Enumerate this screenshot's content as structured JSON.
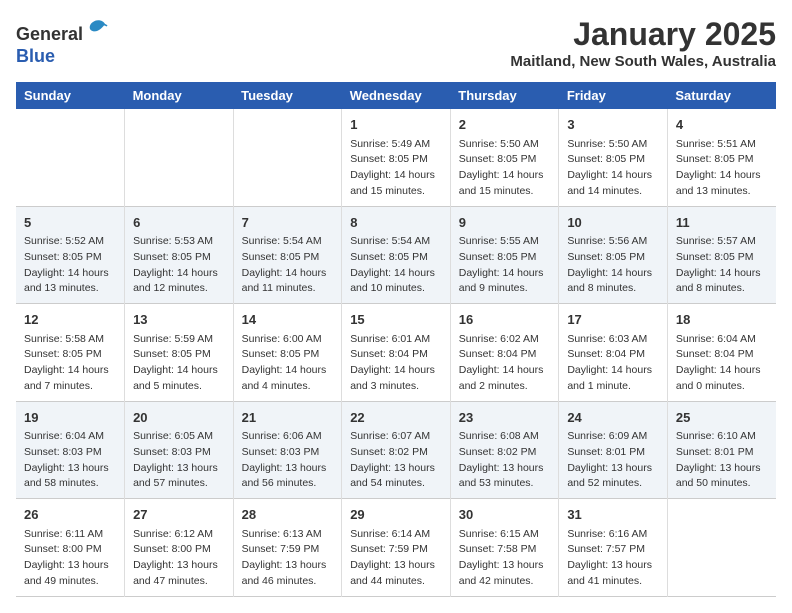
{
  "header": {
    "logo_line1": "General",
    "logo_line2": "Blue",
    "month_year": "January 2025",
    "location": "Maitland, New South Wales, Australia"
  },
  "days_of_week": [
    "Sunday",
    "Monday",
    "Tuesday",
    "Wednesday",
    "Thursday",
    "Friday",
    "Saturday"
  ],
  "weeks": [
    [
      {
        "date": "",
        "info": ""
      },
      {
        "date": "",
        "info": ""
      },
      {
        "date": "",
        "info": ""
      },
      {
        "date": "1",
        "info": "Sunrise: 5:49 AM\nSunset: 8:05 PM\nDaylight: 14 hours and 15 minutes."
      },
      {
        "date": "2",
        "info": "Sunrise: 5:50 AM\nSunset: 8:05 PM\nDaylight: 14 hours and 15 minutes."
      },
      {
        "date": "3",
        "info": "Sunrise: 5:50 AM\nSunset: 8:05 PM\nDaylight: 14 hours and 14 minutes."
      },
      {
        "date": "4",
        "info": "Sunrise: 5:51 AM\nSunset: 8:05 PM\nDaylight: 14 hours and 13 minutes."
      }
    ],
    [
      {
        "date": "5",
        "info": "Sunrise: 5:52 AM\nSunset: 8:05 PM\nDaylight: 14 hours and 13 minutes."
      },
      {
        "date": "6",
        "info": "Sunrise: 5:53 AM\nSunset: 8:05 PM\nDaylight: 14 hours and 12 minutes."
      },
      {
        "date": "7",
        "info": "Sunrise: 5:54 AM\nSunset: 8:05 PM\nDaylight: 14 hours and 11 minutes."
      },
      {
        "date": "8",
        "info": "Sunrise: 5:54 AM\nSunset: 8:05 PM\nDaylight: 14 hours and 10 minutes."
      },
      {
        "date": "9",
        "info": "Sunrise: 5:55 AM\nSunset: 8:05 PM\nDaylight: 14 hours and 9 minutes."
      },
      {
        "date": "10",
        "info": "Sunrise: 5:56 AM\nSunset: 8:05 PM\nDaylight: 14 hours and 8 minutes."
      },
      {
        "date": "11",
        "info": "Sunrise: 5:57 AM\nSunset: 8:05 PM\nDaylight: 14 hours and 8 minutes."
      }
    ],
    [
      {
        "date": "12",
        "info": "Sunrise: 5:58 AM\nSunset: 8:05 PM\nDaylight: 14 hours and 7 minutes."
      },
      {
        "date": "13",
        "info": "Sunrise: 5:59 AM\nSunset: 8:05 PM\nDaylight: 14 hours and 5 minutes."
      },
      {
        "date": "14",
        "info": "Sunrise: 6:00 AM\nSunset: 8:05 PM\nDaylight: 14 hours and 4 minutes."
      },
      {
        "date": "15",
        "info": "Sunrise: 6:01 AM\nSunset: 8:04 PM\nDaylight: 14 hours and 3 minutes."
      },
      {
        "date": "16",
        "info": "Sunrise: 6:02 AM\nSunset: 8:04 PM\nDaylight: 14 hours and 2 minutes."
      },
      {
        "date": "17",
        "info": "Sunrise: 6:03 AM\nSunset: 8:04 PM\nDaylight: 14 hours and 1 minute."
      },
      {
        "date": "18",
        "info": "Sunrise: 6:04 AM\nSunset: 8:04 PM\nDaylight: 14 hours and 0 minutes."
      }
    ],
    [
      {
        "date": "19",
        "info": "Sunrise: 6:04 AM\nSunset: 8:03 PM\nDaylight: 13 hours and 58 minutes."
      },
      {
        "date": "20",
        "info": "Sunrise: 6:05 AM\nSunset: 8:03 PM\nDaylight: 13 hours and 57 minutes."
      },
      {
        "date": "21",
        "info": "Sunrise: 6:06 AM\nSunset: 8:03 PM\nDaylight: 13 hours and 56 minutes."
      },
      {
        "date": "22",
        "info": "Sunrise: 6:07 AM\nSunset: 8:02 PM\nDaylight: 13 hours and 54 minutes."
      },
      {
        "date": "23",
        "info": "Sunrise: 6:08 AM\nSunset: 8:02 PM\nDaylight: 13 hours and 53 minutes."
      },
      {
        "date": "24",
        "info": "Sunrise: 6:09 AM\nSunset: 8:01 PM\nDaylight: 13 hours and 52 minutes."
      },
      {
        "date": "25",
        "info": "Sunrise: 6:10 AM\nSunset: 8:01 PM\nDaylight: 13 hours and 50 minutes."
      }
    ],
    [
      {
        "date": "26",
        "info": "Sunrise: 6:11 AM\nSunset: 8:00 PM\nDaylight: 13 hours and 49 minutes."
      },
      {
        "date": "27",
        "info": "Sunrise: 6:12 AM\nSunset: 8:00 PM\nDaylight: 13 hours and 47 minutes."
      },
      {
        "date": "28",
        "info": "Sunrise: 6:13 AM\nSunset: 7:59 PM\nDaylight: 13 hours and 46 minutes."
      },
      {
        "date": "29",
        "info": "Sunrise: 6:14 AM\nSunset: 7:59 PM\nDaylight: 13 hours and 44 minutes."
      },
      {
        "date": "30",
        "info": "Sunrise: 6:15 AM\nSunset: 7:58 PM\nDaylight: 13 hours and 42 minutes."
      },
      {
        "date": "31",
        "info": "Sunrise: 6:16 AM\nSunset: 7:57 PM\nDaylight: 13 hours and 41 minutes."
      },
      {
        "date": "",
        "info": ""
      }
    ]
  ]
}
